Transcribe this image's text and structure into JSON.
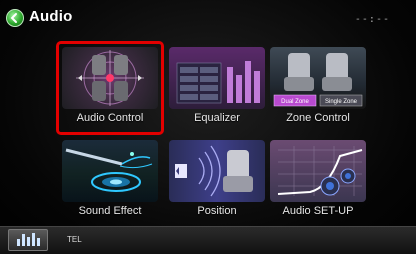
{
  "header": {
    "title": "Audio",
    "clock": "--:--"
  },
  "tiles": [
    {
      "label": "Audio Control",
      "icon": "audio-control-icon",
      "selected": true
    },
    {
      "label": "Equalizer",
      "icon": "equalizer-icon",
      "selected": false
    },
    {
      "label": "Zone Control",
      "icon": "zone-control-icon",
      "selected": false
    },
    {
      "label": "Sound Effect",
      "icon": "sound-effect-icon",
      "selected": false
    },
    {
      "label": "Position",
      "icon": "position-icon",
      "selected": false
    },
    {
      "label": "Audio SET-UP",
      "icon": "audio-setup-icon",
      "selected": false
    }
  ],
  "zone_buttons": {
    "dual": "Dual Zone",
    "single": "Single Zone"
  },
  "footer": {
    "tel_label": "TEL"
  },
  "colors": {
    "selection": "#e30000",
    "back_button": "#2ea82e"
  }
}
